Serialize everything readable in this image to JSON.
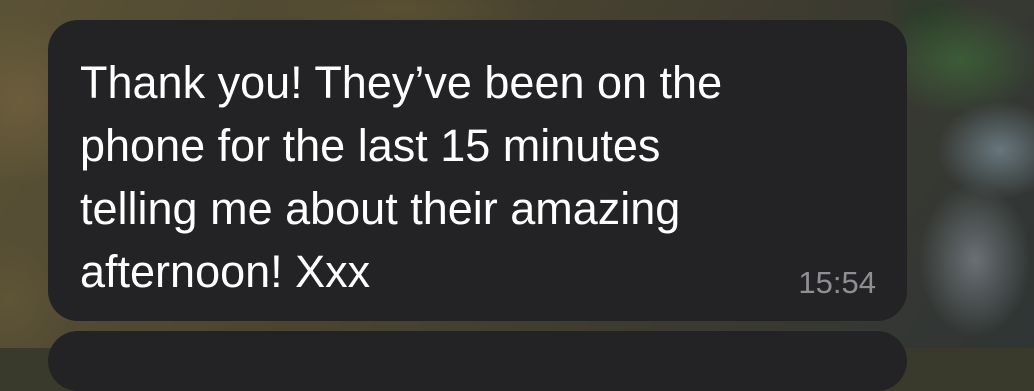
{
  "message": {
    "text": "Thank you! They’ve been on the\nphone for the last 15 minutes\ntelling me about their amazing\nafternoon! Xxx",
    "time": "15:54"
  },
  "colors": {
    "bubble": "#232325",
    "text": "#ffffff",
    "timestamp": "#8e8e93"
  }
}
